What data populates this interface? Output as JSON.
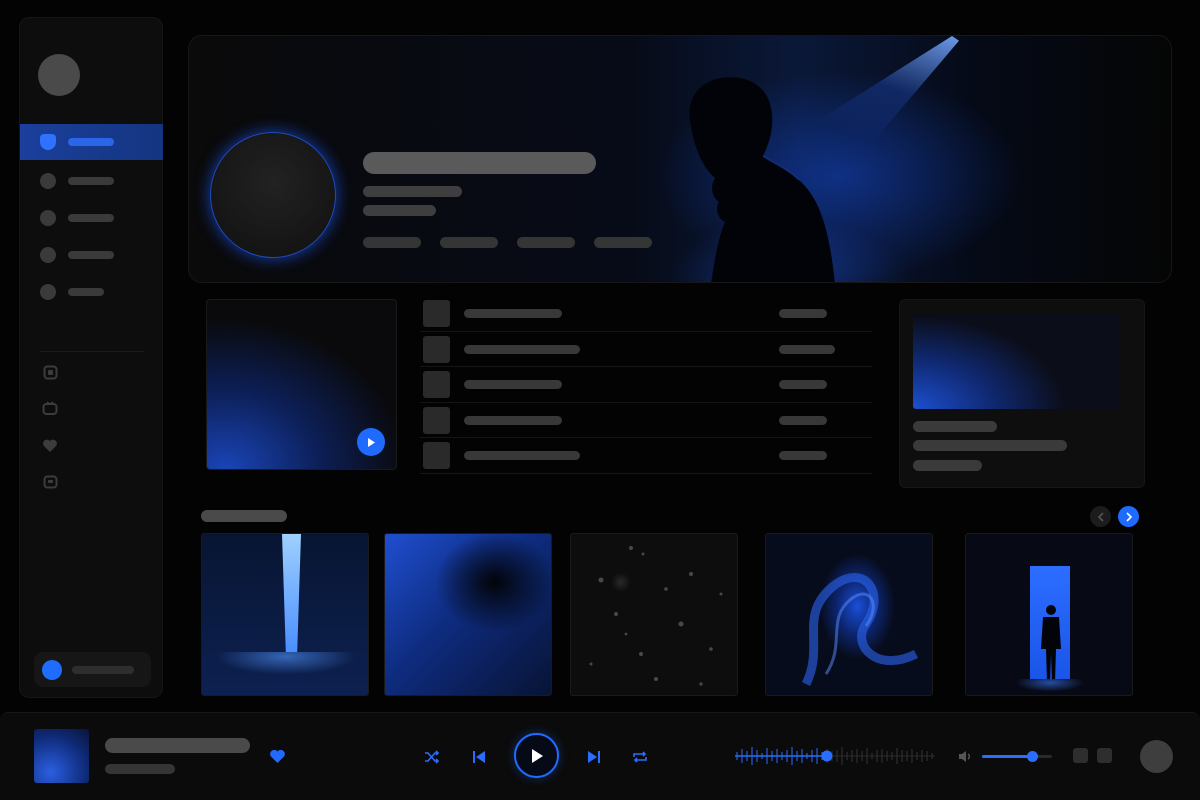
{
  "sidebar": {
    "nav_items": [
      {
        "name": "home",
        "active": true
      },
      {
        "name": "nav-2",
        "active": false
      },
      {
        "name": "nav-3",
        "active": false
      },
      {
        "name": "nav-4",
        "active": false
      },
      {
        "name": "nav-5",
        "active": false
      }
    ],
    "icons": [
      "box-icon",
      "tv-icon",
      "heart-icon",
      "message-icon"
    ]
  },
  "hero": {
    "tags_count": 4
  },
  "track_list": {
    "rows": 5
  },
  "albums": {
    "tiles": [
      "light-beam",
      "blue-gradient",
      "dark-texture",
      "blue-swirl",
      "doorway-figure"
    ]
  },
  "player": {
    "controls": [
      "shuffle-icon",
      "previous-icon",
      "play-icon",
      "next-icon",
      "repeat-icon"
    ],
    "progress": 0.46,
    "volume": 0.72,
    "liked": true
  },
  "colors": {
    "accent": "#1f6bff",
    "background": "#030303",
    "panel": "#0d0d0d",
    "placeholder": "#3a3a3a"
  }
}
